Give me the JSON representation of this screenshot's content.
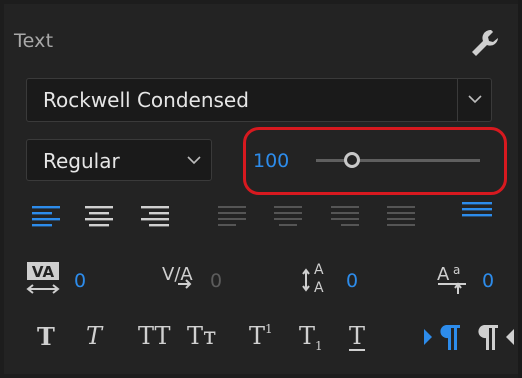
{
  "panel": {
    "title": "Text"
  },
  "font": {
    "family": "Rockwell Condensed",
    "style": "Regular"
  },
  "size": {
    "value": "100",
    "slider_fraction": 0.22
  },
  "tracking": {
    "value": "0"
  },
  "kerning": {
    "value": "0"
  },
  "leading": {
    "value": "0"
  },
  "baseline_shift": {
    "value": "0"
  },
  "style_buttons": {
    "bold": "T",
    "italic": "T",
    "all_caps": "TT",
    "small_caps": "Tт",
    "superscript": "T",
    "superscript_mark": "1",
    "subscript": "T",
    "subscript_mark": "1",
    "underline": "T"
  },
  "icons": {
    "wrench": "wrench-icon",
    "align_left": "align-left-icon",
    "align_center": "align-center-icon",
    "align_right": "align-right-icon",
    "justify_last_left": "justify-last-left-icon",
    "justify_last_center": "justify-last-center-icon",
    "justify_last_right": "justify-last-right-icon",
    "justify_all": "justify-all-icon",
    "top_align": "text-top-align-icon",
    "ltr": "left-to-right-icon",
    "rtl": "right-to-left-icon"
  },
  "colors": {
    "accent": "#2d8ceb",
    "highlight": "#d7191f",
    "panel_bg": "#232323"
  }
}
